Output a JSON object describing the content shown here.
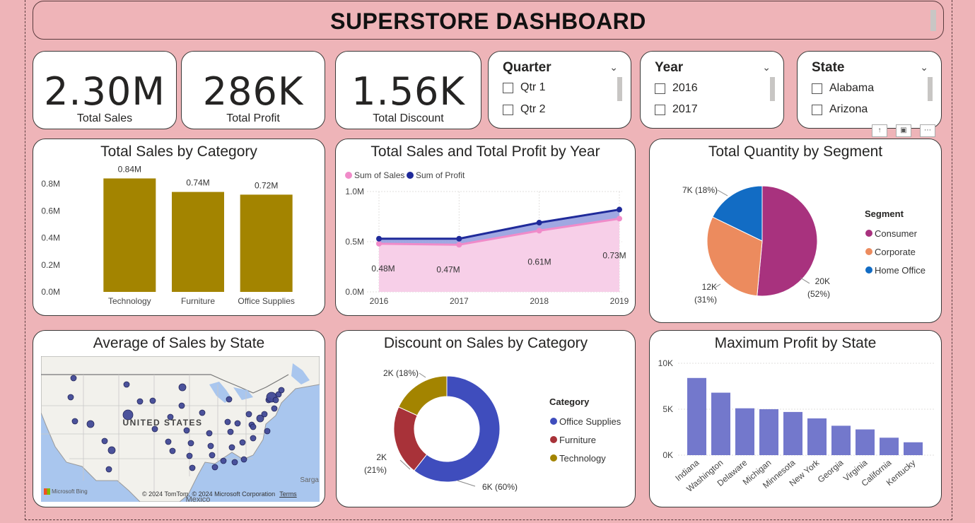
{
  "dashboard": {
    "title": "SUPERSTORE DASHBOARD"
  },
  "kpis": [
    {
      "value": "2.30M",
      "label": "Total Sales"
    },
    {
      "value": "286K",
      "label": "Total Profit"
    },
    {
      "value": "1.56K",
      "label": "Total Discount"
    }
  ],
  "slicers": [
    {
      "title": "Quarter",
      "items": [
        "Qtr 1",
        "Qtr 2"
      ]
    },
    {
      "title": "Year",
      "items": [
        "2016",
        "2017"
      ]
    },
    {
      "title": "State",
      "items": [
        "Alabama",
        "Arizona"
      ]
    }
  ],
  "charts": {
    "sales_by_category": {
      "title": "Total Sales by Category"
    },
    "sales_profit_by_year": {
      "title": "Total Sales and Total Profit by Year"
    },
    "quantity_by_segment": {
      "title": "Total Quantity by Segment"
    },
    "avg_sales_by_state": {
      "title": "Average of Sales by State"
    },
    "discount_by_category": {
      "title": "Discount on Sales by Category"
    },
    "max_profit_by_state": {
      "title": "Maximum Profit by State"
    }
  },
  "map": {
    "country_label": "UNITED STATES",
    "mexico_label": "Mexico",
    "sarga_label": "Sarga",
    "logo_text": "Microsoft Bing",
    "copyright": "© 2024 TomTom, © 2024 Microsoft Corporation",
    "terms": "Terms"
  },
  "chart_data": [
    {
      "type": "bar",
      "title": "Total Sales by Category",
      "categories": [
        "Technology",
        "Furniture",
        "Office Supplies"
      ],
      "values": [
        0.84,
        0.74,
        0.72
      ],
      "value_labels": [
        "0.84M",
        "0.74M",
        "0.72M"
      ],
      "ylim": [
        0,
        0.9
      ],
      "yticks": [
        "0.0M",
        "0.2M",
        "0.4M",
        "0.6M",
        "0.8M"
      ],
      "ytick_values": [
        0,
        0.2,
        0.4,
        0.6,
        0.8
      ],
      "color": "#a38400"
    },
    {
      "type": "area",
      "title": "Total Sales and Total Profit by Year",
      "x": [
        "2016",
        "2017",
        "2018",
        "2019"
      ],
      "series": [
        {
          "name": "Sum of Sales",
          "values": [
            0.48,
            0.47,
            0.61,
            0.73
          ],
          "labels": [
            "0.48M",
            "0.47M",
            "0.61M",
            "0.73M"
          ],
          "color": "#f08bc9"
        },
        {
          "name": "Sum of Profit",
          "values": [
            0.53,
            0.53,
            0.69,
            0.82
          ],
          "color": "#1f2a9a"
        }
      ],
      "ylim": [
        0,
        1.0
      ],
      "yticks": [
        "0.0M",
        "0.5M",
        "1.0M"
      ],
      "ytick_values": [
        0,
        0.5,
        1.0
      ]
    },
    {
      "type": "pie",
      "title": "Total Quantity by Segment",
      "legend_title": "Segment",
      "labels": [
        "Consumer",
        "Corporate",
        "Home Office"
      ],
      "values": [
        52,
        31,
        18
      ],
      "slice_labels": [
        "20K\n(52%)",
        "12K\n(31%)",
        "7K (18%)"
      ],
      "colors": [
        "#a8327e",
        "#ec8b5e",
        "#126cc4"
      ]
    },
    {
      "type": "pie",
      "donut": true,
      "title": "Discount on Sales by Category",
      "legend_title": "Category",
      "labels": [
        "Office Supplies",
        "Furniture",
        "Technology"
      ],
      "values": [
        60,
        21,
        18
      ],
      "slice_labels": [
        "6K (60%)",
        "2K\n(21%)",
        "2K (18%)"
      ],
      "colors": [
        "#3f4dbd",
        "#a83239",
        "#a38400"
      ]
    },
    {
      "type": "bar",
      "title": "Maximum Profit by State",
      "categories": [
        "Indiana",
        "Washington",
        "Delaware",
        "Michigan",
        "Minnesota",
        "New York",
        "Georgia",
        "Virginia",
        "California",
        "Kentucky"
      ],
      "values": [
        8.4,
        6.8,
        5.1,
        5.0,
        4.7,
        4.0,
        3.2,
        2.8,
        1.9,
        1.4
      ],
      "ylim": [
        0,
        10
      ],
      "yticks": [
        "0K",
        "5K",
        "10K"
      ],
      "ytick_values": [
        0,
        5,
        10
      ],
      "color": "#7378cc"
    }
  ]
}
